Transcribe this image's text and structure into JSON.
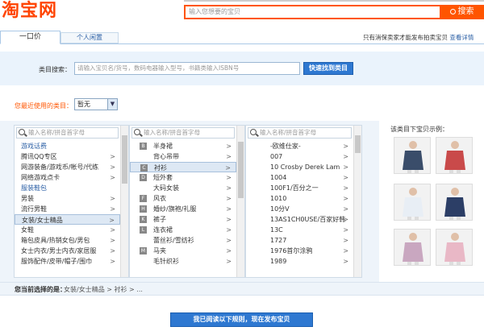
{
  "header": {
    "logo_text": "淘宝网",
    "search_placeholder": "输入您想要的宝贝",
    "search_button": "搜索"
  },
  "tabs": [
    {
      "label": "一口价",
      "active": true
    },
    {
      "label": "个人闲置",
      "active": false
    }
  ],
  "notice": {
    "text": "只有消保卖家才能发布拍卖宝贝",
    "link": "查看详情"
  },
  "category_search": {
    "label": "类目搜索：",
    "placeholder": "请输入宝贝名/货号，数码电器输入型号，书籍类输入ISBN号",
    "button": "快速找到类目"
  },
  "recent": {
    "label": "您最近使用的类目：",
    "value": "暂无"
  },
  "filter_placeholder": "输入名称/拼音首字母",
  "panel1": [
    {
      "text": "游戏话费",
      "group": true
    },
    {
      "text": "腾讯QQ专区",
      "chev": true
    },
    {
      "text": "网游装备/游戏币/帐号/代练",
      "chev": true
    },
    {
      "text": "网络游戏点卡",
      "chev": true
    },
    {
      "text": "服装鞋包",
      "group": true
    },
    {
      "text": "男装",
      "chev": true
    },
    {
      "text": "流行男鞋",
      "chev": true
    },
    {
      "text": "女装/女士精品",
      "chev": true,
      "selected": true
    },
    {
      "text": "女鞋",
      "chev": true
    },
    {
      "text": "箱包皮具/热销女包/男包",
      "chev": true
    },
    {
      "text": "女士内衣/男士内衣/家居服",
      "chev": true
    },
    {
      "text": "服饰配件/皮带/帽子/围巾",
      "chev": true
    }
  ],
  "panel2": [
    {
      "letter": "B",
      "text": "半身裙",
      "chev": true
    },
    {
      "letter": "",
      "text": "背心吊带",
      "chev": true
    },
    {
      "letter": "C",
      "text": "衬衫",
      "chev": true,
      "selected": true
    },
    {
      "letter": "D",
      "text": "短外套",
      "chev": true
    },
    {
      "letter": "",
      "text": "大码女装",
      "chev": true
    },
    {
      "letter": "F",
      "text": "风衣",
      "chev": true
    },
    {
      "letter": "H",
      "text": "婚纱/旗袍/礼服",
      "chev": true
    },
    {
      "letter": "K",
      "text": "裤子",
      "chev": true
    },
    {
      "letter": "L",
      "text": "连衣裙",
      "chev": true
    },
    {
      "letter": "",
      "text": "蕾丝衫/雪纺衫",
      "chev": true
    },
    {
      "letter": "M",
      "text": "马夹",
      "chev": true
    },
    {
      "letter": "",
      "text": "毛针织衫",
      "chev": true
    }
  ],
  "panel3": [
    {
      "text": "-欧维仕家-",
      "chev": true
    },
    {
      "text": "007",
      "chev": true
    },
    {
      "text": "10 Crosby Derek Lam",
      "chev": true
    },
    {
      "text": "1004",
      "chev": true
    },
    {
      "text": "100F1/百分之一",
      "chev": true
    },
    {
      "text": "1010",
      "chev": true
    },
    {
      "text": "10分V",
      "chev": true
    },
    {
      "text": "13AS1CH0USE/百家好韩",
      "chev": true
    },
    {
      "text": "13C",
      "chev": true
    },
    {
      "text": "1727",
      "chev": true
    },
    {
      "text": "1976首尔涂鸦",
      "chev": true
    },
    {
      "text": "1989",
      "chev": true
    }
  ],
  "examples": {
    "label": "该类目下宝贝示例：",
    "colors": [
      "#3a4d6a",
      "#c94a4a",
      "#e8eef5",
      "#2c3e66",
      "#c9a7c0",
      "#e9b8c6"
    ]
  },
  "selected_path": {
    "label": "您当前选择的是：",
    "value": "女装/女士精品 > 衬衫 > ..."
  },
  "publish_button": "我已阅读以下规则，现在发布宝贝"
}
